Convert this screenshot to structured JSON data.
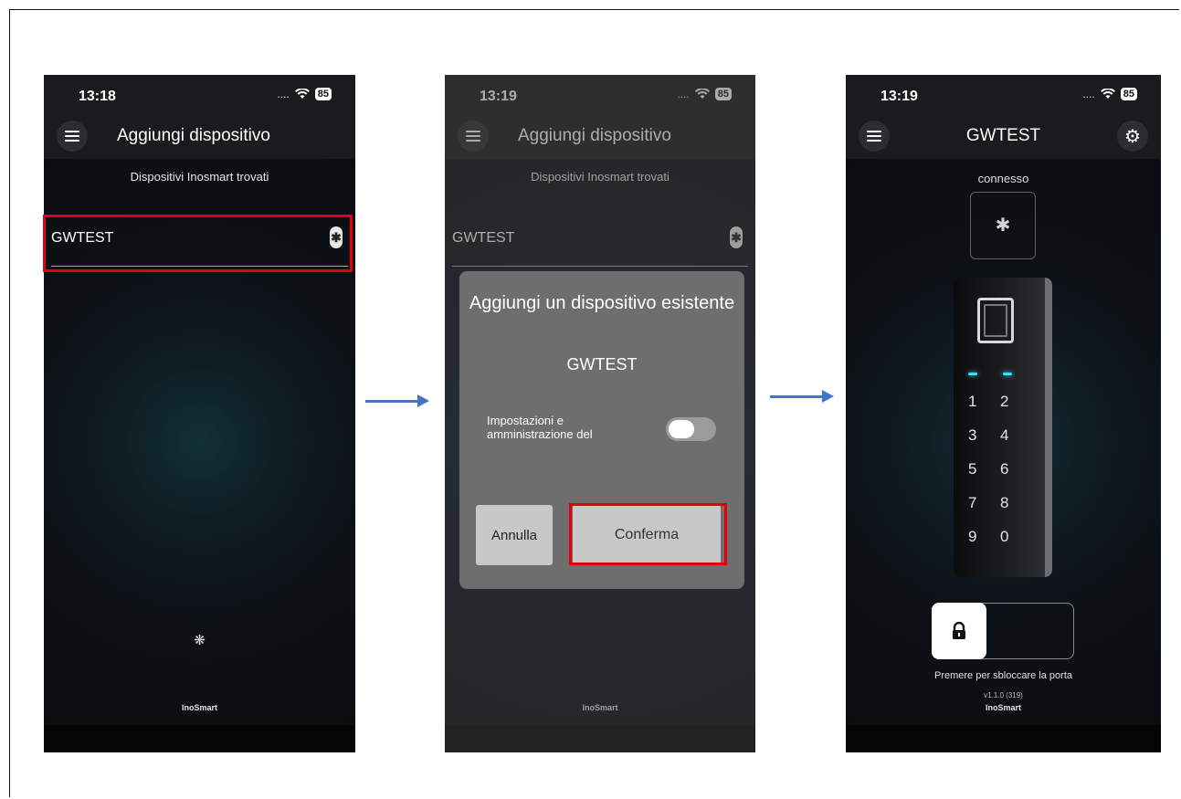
{
  "screens": [
    {
      "time": "13:18",
      "signal": "....",
      "battery": "85",
      "app_title": "Aggiungi dispositivo",
      "subtitle": "Dispositivi Inosmart trovati",
      "device_name": "GWTEST",
      "brand": "ĭnoSmart"
    },
    {
      "time": "13:19",
      "signal": "....",
      "battery": "85",
      "app_title": "Aggiungi dispositivo",
      "subtitle": "Dispositivi Inosmart trovati",
      "device_name": "GWTEST",
      "brand": "ĭnoSmart",
      "dialog": {
        "title": "Aggiungi un dispositivo esistente",
        "device": "GWTEST",
        "option_label": "Impostazioni e amministrazione del",
        "cancel_label": "Annulla",
        "confirm_label": "Conferma"
      }
    },
    {
      "time": "13:19",
      "signal": "....",
      "battery": "85",
      "app_title": "GWTEST",
      "status": "connesso",
      "keys": [
        "1",
        "2",
        "3",
        "4",
        "5",
        "6",
        "7",
        "8",
        "9",
        "0"
      ],
      "hint": "Premere per sbloccare la porta",
      "version": "v1.1.0 (319)",
      "brand": "ĭnoSmart"
    }
  ],
  "colors": {
    "highlight": "#e3000b",
    "arrow": "#4472c4",
    "led": "#39e1f5"
  },
  "icons": [
    "menu-icon",
    "wifi-icon",
    "battery-icon",
    "bluetooth-icon",
    "spinner-icon",
    "gear-icon",
    "lock-icon",
    "arrow-right-icon"
  ]
}
